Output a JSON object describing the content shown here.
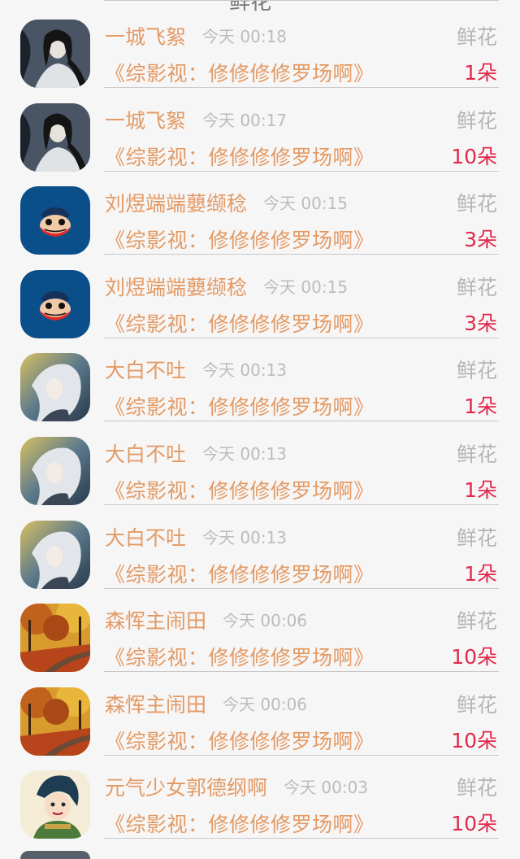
{
  "header_peek": {
    "title": "鲜花"
  },
  "time_prefix": "今天",
  "items": [
    {
      "user": "一城飞絮",
      "time": "00:18",
      "gift_type": "鲜花",
      "book": "《综影视：修修修修罗场啊》",
      "count": "1朵",
      "avatar": "ink-swordsman"
    },
    {
      "user": "一城飞絮",
      "time": "00:17",
      "gift_type": "鲜花",
      "book": "《综影视：修修修修罗场啊》",
      "count": "10朵",
      "avatar": "ink-swordsman"
    },
    {
      "user": "刘煜端端蘡缬稔",
      "time": "00:15",
      "gift_type": "鲜花",
      "book": "《综影视：修修修修罗场啊》",
      "count": "3朵",
      "avatar": "monkey-logo"
    },
    {
      "user": "刘煜端端蘡缬稔",
      "time": "00:15",
      "gift_type": "鲜花",
      "book": "《综影视：修修修修罗场啊》",
      "count": "3朵",
      "avatar": "monkey-logo"
    },
    {
      "user": "大白不吐",
      "time": "00:13",
      "gift_type": "鲜花",
      "book": "《综影视：修修修修罗场啊》",
      "count": "1朵",
      "avatar": "silver-hair"
    },
    {
      "user": "大白不吐",
      "time": "00:13",
      "gift_type": "鲜花",
      "book": "《综影视：修修修修罗场啊》",
      "count": "1朵",
      "avatar": "silver-hair"
    },
    {
      "user": "大白不吐",
      "time": "00:13",
      "gift_type": "鲜花",
      "book": "《综影视：修修修修罗场啊》",
      "count": "1朵",
      "avatar": "silver-hair"
    },
    {
      "user": "森恽主闹田",
      "time": "00:06",
      "gift_type": "鲜花",
      "book": "《综影视：修修修修罗场啊》",
      "count": "10朵",
      "avatar": "autumn-road"
    },
    {
      "user": "森恽主闹田",
      "time": "00:06",
      "gift_type": "鲜花",
      "book": "《综影视：修修修修罗场啊》",
      "count": "10朵",
      "avatar": "autumn-road"
    },
    {
      "user": "元气少女郭德纲啊",
      "time": "00:03",
      "gift_type": "鲜花",
      "book": "《综影视：修修修修罗场啊》",
      "count": "10朵",
      "avatar": "anime-warrior"
    }
  ]
}
